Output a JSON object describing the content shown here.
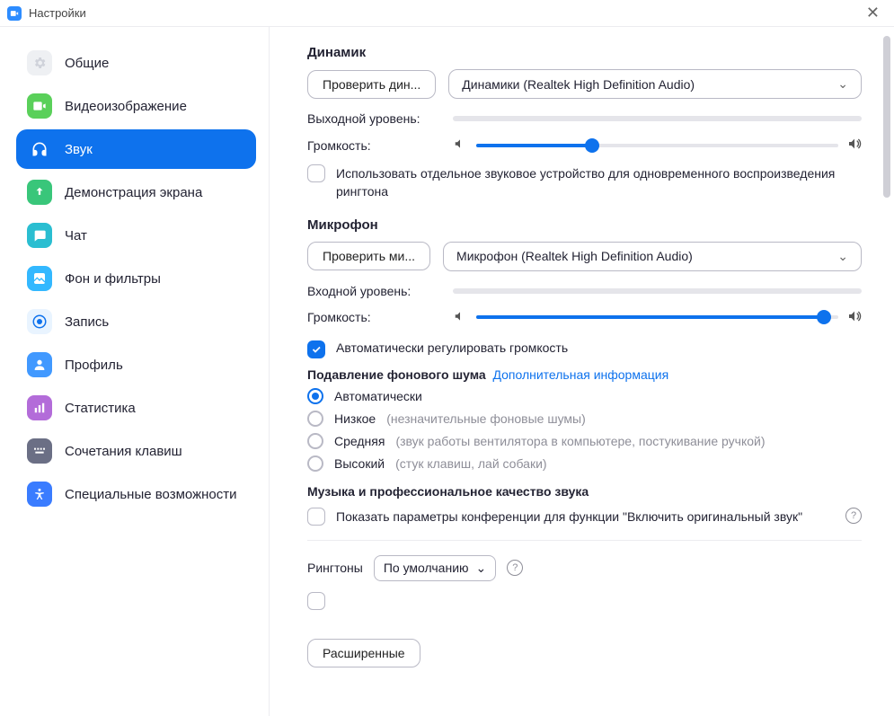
{
  "titlebar": {
    "title": "Настройки"
  },
  "sidebar": {
    "items": [
      {
        "label": "Общие"
      },
      {
        "label": "Видеоизображение"
      },
      {
        "label": "Звук"
      },
      {
        "label": "Демонстрация экрана"
      },
      {
        "label": "Чат"
      },
      {
        "label": "Фон и фильтры"
      },
      {
        "label": "Запись"
      },
      {
        "label": "Профиль"
      },
      {
        "label": "Статистика"
      },
      {
        "label": "Сочетания клавиш"
      },
      {
        "label": "Специальные возможности"
      }
    ]
  },
  "speaker": {
    "title": "Динамик",
    "test_btn": "Проверить дин...",
    "device": "Динамики (Realtek High Definition Audio)",
    "output_level_label": "Выходной уровень:",
    "volume_label": "Громкость:",
    "volume_percent": 32,
    "separate_ringtone_label": "Использовать отдельное звуковое устройство для одновременного воспроизведения рингтона"
  },
  "mic": {
    "title": "Микрофон",
    "test_btn": "Проверить ми...",
    "device": "Микрофон (Realtek High Definition Audio)",
    "input_level_label": "Входной уровень:",
    "volume_label": "Громкость:",
    "volume_percent": 96,
    "auto_adjust_label": "Автоматически регулировать громкость"
  },
  "noise": {
    "title": "Подавление фонового шума",
    "more_info": "Дополнительная информация",
    "options": {
      "auto": {
        "label": "Автоматически",
        "hint": ""
      },
      "low": {
        "label": "Низкое",
        "hint": "(незначительные фоновые шумы)"
      },
      "med": {
        "label": "Средняя",
        "hint": "(звук работы вентилятора в компьютере, постукивание ручкой)"
      },
      "high": {
        "label": "Высокий",
        "hint": "(стук клавиш, лай собаки)"
      }
    }
  },
  "music": {
    "title": "Музыка и профессиональное качество звука",
    "original_sound_label": "Показать параметры конференции для функции \"Включить оригинальный звук\""
  },
  "ringtone": {
    "label": "Рингтоны",
    "selected": "По умолчанию"
  },
  "advanced_btn": "Расширенные"
}
